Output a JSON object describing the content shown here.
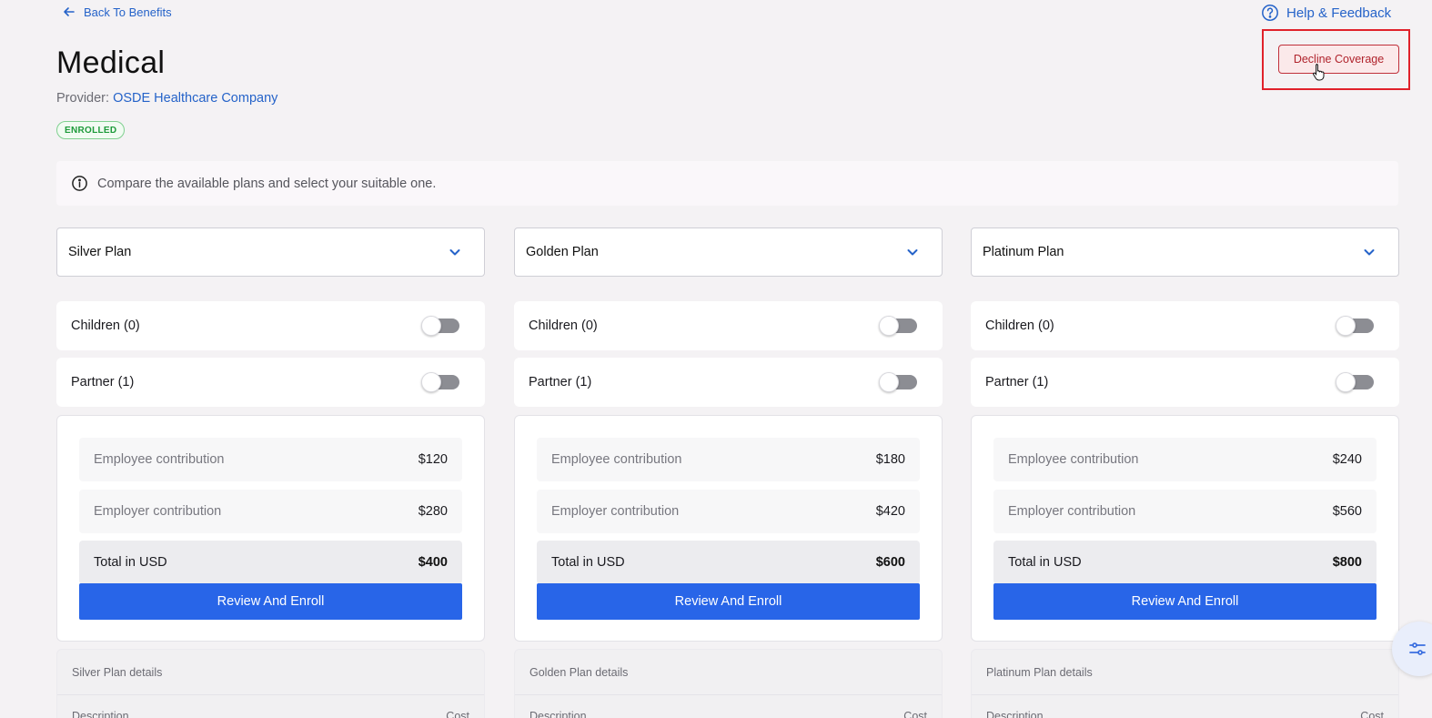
{
  "nav": {
    "back_label": "Back To Benefits",
    "help_label": "Help & Feedback"
  },
  "header": {
    "title": "Medical",
    "provider_prefix": "Provider:",
    "provider_name": "OSDE Healthcare Company",
    "status": "ENROLLED",
    "decline_label": "Decline Coverage"
  },
  "banner": {
    "text": "Compare the available plans and select your suitable one."
  },
  "plans": [
    {
      "select_value": "Silver Plan",
      "children_label": "Children (0)",
      "children_on": false,
      "partner_label": "Partner (1)",
      "partner_on": false,
      "employee_label": "Employee contribution",
      "employee_value": "$120",
      "employer_label": "Employer contribution",
      "employer_value": "$280",
      "total_label": "Total in USD",
      "total_value": "$400",
      "enroll_label": "Review And Enroll",
      "details_title": "Silver Plan details",
      "details_col_description": "Description",
      "details_col_cost": "Cost"
    },
    {
      "select_value": "Golden Plan",
      "children_label": "Children (0)",
      "children_on": false,
      "partner_label": "Partner (1)",
      "partner_on": false,
      "employee_label": "Employee contribution",
      "employee_value": "$180",
      "employer_label": "Employer contribution",
      "employer_value": "$420",
      "total_label": "Total in USD",
      "total_value": "$600",
      "enroll_label": "Review And Enroll",
      "details_title": "Golden Plan details",
      "details_col_description": "Description",
      "details_col_cost": "Cost"
    },
    {
      "select_value": "Platinum Plan",
      "children_label": "Children (0)",
      "children_on": false,
      "partner_label": "Partner (1)",
      "partner_on": false,
      "employee_label": "Employee contribution",
      "employee_value": "$240",
      "employer_label": "Employer contribution",
      "employer_value": "$560",
      "total_label": "Total in USD",
      "total_value": "$800",
      "enroll_label": "Review And Enroll",
      "details_title": "Platinum Plan details",
      "details_col_description": "Description",
      "details_col_cost": "Cost"
    }
  ],
  "icons": {
    "back": "arrow-left-icon",
    "help": "question-circle-icon",
    "info": "info-circle-icon",
    "select": "chevron-down-icon",
    "fab": "sliders-icon"
  },
  "colors": {
    "accent": "#2563c9",
    "primary_button": "#2865e8",
    "decline": "#b0232c",
    "enrolled": "#1d9a3a",
    "highlight": "#e0222b"
  }
}
